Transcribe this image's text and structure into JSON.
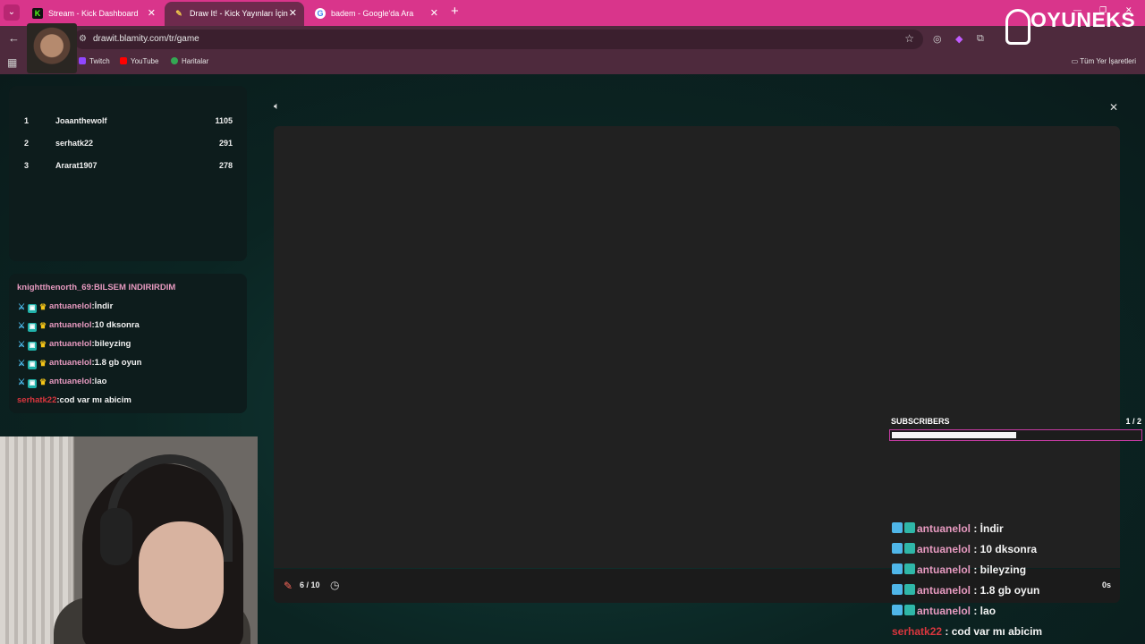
{
  "browser": {
    "tabs": [
      {
        "label": "Stream - Kick Dashboard",
        "active": false,
        "favicon": "kick-icon",
        "favicon_color": "#53fc18"
      },
      {
        "label": "Draw It! - Kick Yayınları İçin Çizi",
        "active": true,
        "favicon": "pencil-icon",
        "favicon_color": "#f2c94c"
      },
      {
        "label": "badem - Google'da Ara",
        "active": false,
        "favicon": "google-icon",
        "favicon_color": "#ffffff"
      }
    ],
    "url": "drawit.blamity.com/tr/game",
    "bookmarks": [
      "Twitch",
      "YouTube",
      "Haritalar"
    ],
    "all_bookmarks": "Tüm Yer İşaretleri",
    "accent": "#d9358b"
  },
  "overlay_logo": "OYUNEKS",
  "leaderboard": [
    {
      "rank": "1",
      "name": "Joaanthewolf",
      "score": "1105"
    },
    {
      "rank": "2",
      "name": "serhatk22",
      "score": "291"
    },
    {
      "rank": "3",
      "name": "Ararat1907",
      "score": "278"
    }
  ],
  "chat": {
    "cut_line": "knightthenorth_69:BILSEM INDIRIRDIM",
    "messages": [
      {
        "user": "antuanelol",
        "text": ":İndir",
        "badges": true,
        "color": "#e79ac0"
      },
      {
        "user": "antuanelol",
        "text": ":10 dksonra",
        "badges": true,
        "color": "#e79ac0"
      },
      {
        "user": "antuanelol",
        "text": ":bileyzing",
        "badges": true,
        "color": "#e79ac0"
      },
      {
        "user": "antuanelol",
        "text": ":1.8 gb oyun",
        "badges": true,
        "color": "#e79ac0"
      },
      {
        "user": "antuanelol",
        "text": ":lao",
        "badges": true,
        "color": "#e79ac0"
      },
      {
        "user": "serhatk22",
        "text": ":cod var mı abicim",
        "badges": false,
        "color": "#d9363e"
      }
    ]
  },
  "game": {
    "round": "6 / 10",
    "timer": "0s"
  },
  "subscribers": {
    "label": "SUBSCRIBERS",
    "count": "1 / 2",
    "progress": 0.5
  },
  "overlay_chat": [
    {
      "user": "antuanelol",
      "text": " : İndir",
      "badges": true
    },
    {
      "user": "antuanelol",
      "text": " : 10 dksonra",
      "badges": true
    },
    {
      "user": "antuanelol",
      "text": " : bileyzing",
      "badges": true
    },
    {
      "user": "antuanelol",
      "text": " : 1.8 gb oyun",
      "badges": true
    },
    {
      "user": "antuanelol",
      "text": " : lao",
      "badges": true
    },
    {
      "user": "serhatk22",
      "text": " : cod var mı abicim",
      "badges": false
    }
  ]
}
